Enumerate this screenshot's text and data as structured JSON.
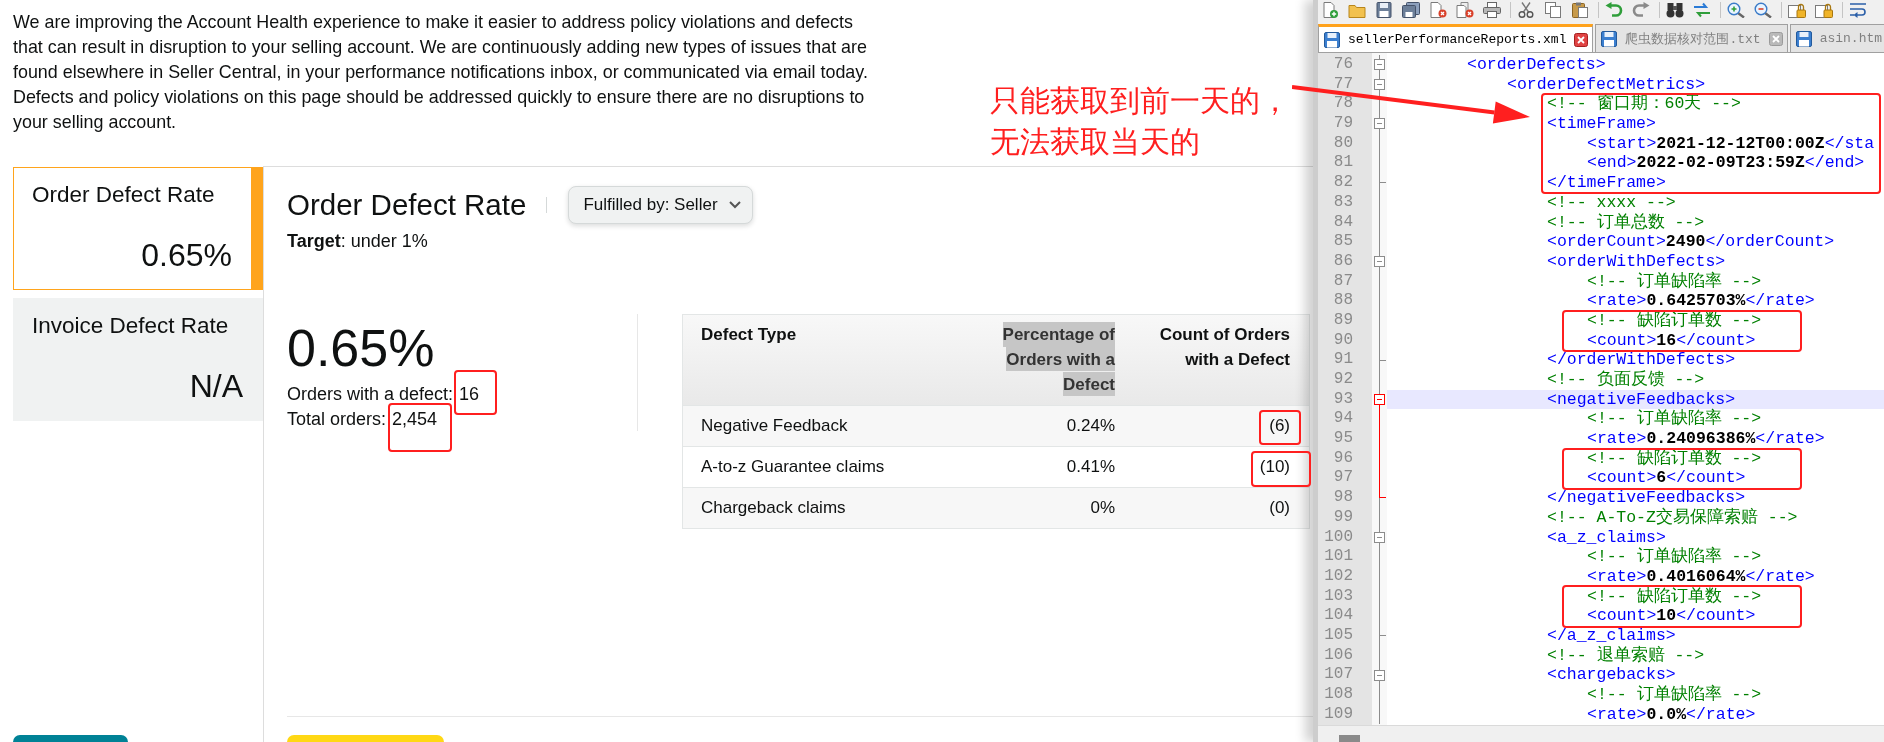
{
  "intro": {
    "text": "We are improving the Account Health experience to make it easier to address policy violations and defects that can result in disruption to your selling account. We are continuously adding new types of issues that are found elsewhere in Seller Central, in your performance notifications inbox, or communicated via email today. Defects and policy violations on this page should be addressed quickly to ensure there are no disruptions to your selling account."
  },
  "metric_tabs": [
    {
      "label": "Order Defect Rate",
      "value": "0.65%",
      "selected": true
    },
    {
      "label": "Invoice Defect Rate",
      "value": "N/A",
      "selected": false
    }
  ],
  "detail": {
    "title": "Order Defect Rate",
    "filter": "Fulfilled by: Seller",
    "target": "**Target**: under 1%",
    "rate": "0.65%",
    "stats": [
      {
        "label": "Orders with a defect:",
        "value": "16"
      },
      {
        "label": "Total orders:",
        "value": "2,454"
      }
    ]
  },
  "table": {
    "columns": [
      {
        "label": "Defect Type",
        "text_selected": false
      },
      {
        "label": "Percentage of Orders with a Defect",
        "text_selected": true
      },
      {
        "label": "Count of Orders with a Defect",
        "text_selected": false
      }
    ],
    "rows": [
      [
        "Negative Feedback",
        "0.24%",
        "(6)"
      ],
      [
        "A-to-z Guarantee claims",
        "0.41%",
        "(10)"
      ],
      [
        "Chargeback claims",
        "0%",
        "(0)"
      ]
    ]
  },
  "editor": {
    "tabs": [
      {
        "label": "sellerPerformanceReports.xml",
        "selected": true,
        "close_icon": true
      },
      {
        "label": "爬虫数据核对范围.txt",
        "selected": false,
        "close_icon": true
      },
      {
        "label": "asin.htm",
        "selected": false,
        "close_icon": false
      }
    ],
    "lines": [
      {
        "number": "76",
        "current": false,
        "segments": [
          {
            "kind": "tag",
            "text": "<orderDefects>"
          }
        ],
        "children": [
          {
            "number": "77",
            "current": false,
            "segments": [
              {
                "kind": "tag",
                "text": "<orderDefectMetrics>"
              }
            ],
            "children": [
              {
                "number": "78",
                "current": false,
                "segments": [
                  {
                    "kind": "comment",
                    "text": "<!-- 窗口期：60天 -->"
                  }
                ]
              },
              {
                "number": "79",
                "current": false,
                "segments": [
                  {
                    "kind": "tag",
                    "text": "<timeFrame>"
                  }
                ],
                "children": [
                  {
                    "number": "80",
                    "current": false,
                    "segments": [
                      {
                        "kind": "tag",
                        "text": "<start>"
                      },
                      {
                        "kind": "value",
                        "text": "2021-12-12T00:00Z"
                      },
                      {
                        "kind": "tag",
                        "text": "</sta"
                      }
                    ]
                  },
                  {
                    "number": "81",
                    "current": false,
                    "segments": [
                      {
                        "kind": "tag",
                        "text": "<end>"
                      },
                      {
                        "kind": "value",
                        "text": "2022-02-09T23:59Z"
                      },
                      {
                        "kind": "tag",
                        "text": "</end>"
                      }
                    ]
                  }
                ]
              },
              {
                "number": "82",
                "current": false,
                "segments": [
                  {
                    "kind": "tag",
                    "text": "</timeFrame>"
                  }
                ]
              },
              {
                "number": "83",
                "current": false,
                "segments": [
                  {
                    "kind": "comment",
                    "text": "<!-- xxxx -->"
                  }
                ]
              },
              {
                "number": "84",
                "current": false,
                "segments": [
                  {
                    "kind": "comment",
                    "text": "<!-- 订单总数 -->"
                  }
                ]
              },
              {
                "number": "85",
                "current": false,
                "segments": [
                  {
                    "kind": "tag",
                    "text": "<orderCount>"
                  },
                  {
                    "kind": "value",
                    "text": "2490"
                  },
                  {
                    "kind": "tag",
                    "text": "</orderCount>"
                  }
                ]
              },
              {
                "number": "86",
                "current": false,
                "segments": [
                  {
                    "kind": "tag",
                    "text": "<orderWithDefects>"
                  }
                ],
                "children": [
                  {
                    "number": "87",
                    "current": false,
                    "segments": [
                      {
                        "kind": "comment",
                        "text": "<!-- 订单缺陷率 -->"
                      }
                    ]
                  },
                  {
                    "number": "88",
                    "current": false,
                    "segments": [
                      {
                        "kind": "tag",
                        "text": "<rate>"
                      },
                      {
                        "kind": "value",
                        "text": "0.6425703%"
                      },
                      {
                        "kind": "tag",
                        "text": "</rate>"
                      }
                    ]
                  },
                  {
                    "number": "89",
                    "current": false,
                    "segments": [
                      {
                        "kind": "comment",
                        "text": "<!-- 缺陷订单数 -->"
                      }
                    ]
                  },
                  {
                    "number": "90",
                    "current": false,
                    "segments": [
                      {
                        "kind": "tag",
                        "text": "<count>"
                      },
                      {
                        "kind": "value",
                        "text": "16"
                      },
                      {
                        "kind": "tag",
                        "text": "</count>"
                      }
                    ]
                  }
                ]
              },
              {
                "number": "91",
                "current": false,
                "segments": [
                  {
                    "kind": "tag",
                    "text": "</orderWithDefects>"
                  }
                ]
              },
              {
                "number": "92",
                "current": false,
                "segments": [
                  {
                    "kind": "comment",
                    "text": "<!-- 负面反馈 -->"
                  }
                ]
              },
              {
                "number": "93",
                "current": true,
                "segments": [
                  {
                    "kind": "tag",
                    "text": "<negativeFeedbacks>"
                  }
                ],
                "children": [
                  {
                    "number": "94",
                    "current": false,
                    "segments": [
                      {
                        "kind": "comment",
                        "text": "<!-- 订单缺陷率 -->"
                      }
                    ]
                  },
                  {
                    "number": "95",
                    "current": false,
                    "segments": [
                      {
                        "kind": "tag",
                        "text": "<rate>"
                      },
                      {
                        "kind": "value",
                        "text": "0.24096386%"
                      },
                      {
                        "kind": "tag",
                        "text": "</rate>"
                      }
                    ]
                  },
                  {
                    "number": "96",
                    "current": false,
                    "segments": [
                      {
                        "kind": "comment",
                        "text": "<!-- 缺陷订单数 -->"
                      }
                    ]
                  },
                  {
                    "number": "97",
                    "current": false,
                    "segments": [
                      {
                        "kind": "tag",
                        "text": "<count>"
                      },
                      {
                        "kind": "value",
                        "text": "6"
                      },
                      {
                        "kind": "tag",
                        "text": "</count>"
                      }
                    ]
                  }
                ]
              },
              {
                "number": "98",
                "current": false,
                "segments": [
                  {
                    "kind": "tag",
                    "text": "</negativeFeedbacks>"
                  }
                ]
              },
              {
                "number": "99",
                "current": false,
                "segments": [
                  {
                    "kind": "comment",
                    "text": "<!-- A-To-Z交易保障索赔 -->"
                  }
                ]
              },
              {
                "number": "100",
                "current": false,
                "segments": [
                  {
                    "kind": "tag",
                    "text": "<a_z_claims>"
                  }
                ],
                "children": [
                  {
                    "number": "101",
                    "current": false,
                    "segments": [
                      {
                        "kind": "comment",
                        "text": "<!-- 订单缺陷率 -->"
                      }
                    ]
                  },
                  {
                    "number": "102",
                    "current": false,
                    "segments": [
                      {
                        "kind": "tag",
                        "text": "<rate>"
                      },
                      {
                        "kind": "value",
                        "text": "0.4016064%"
                      },
                      {
                        "kind": "tag",
                        "text": "</rate>"
                      }
                    ]
                  },
                  {
                    "number": "103",
                    "current": false,
                    "segments": [
                      {
                        "kind": "comment",
                        "text": "<!-- 缺陷订单数 -->"
                      }
                    ]
                  },
                  {
                    "number": "104",
                    "current": false,
                    "segments": [
                      {
                        "kind": "tag",
                        "text": "<count>"
                      },
                      {
                        "kind": "value",
                        "text": "10"
                      },
                      {
                        "kind": "tag",
                        "text": "</count>"
                      }
                    ]
                  }
                ]
              },
              {
                "number": "105",
                "current": false,
                "segments": [
                  {
                    "kind": "tag",
                    "text": "</a_z_claims>"
                  }
                ]
              },
              {
                "number": "106",
                "current": false,
                "segments": [
                  {
                    "kind": "comment",
                    "text": "<!-- 退单索赔 -->"
                  }
                ]
              },
              {
                "number": "107",
                "current": false,
                "segments": [
                  {
                    "kind": "tag",
                    "text": "<chargebacks>"
                  }
                ],
                "children": [
                  {
                    "number": "108",
                    "current": false,
                    "segments": [
                      {
                        "kind": "comment",
                        "text": "<!-- 订单缺陷率 -->"
                      }
                    ]
                  },
                  {
                    "number": "109",
                    "current": false,
                    "segments": [
                      {
                        "kind": "tag",
                        "text": "<rate>"
                      },
                      {
                        "kind": "value",
                        "text": "0.0%"
                      },
                      {
                        "kind": "tag",
                        "text": "</rate>"
                      }
                    ]
                  }
                ]
              }
            ]
          }
        ]
      }
    ]
  },
  "annotation": {
    "text": "只能获取到前一天的，无法获取当天的"
  }
}
